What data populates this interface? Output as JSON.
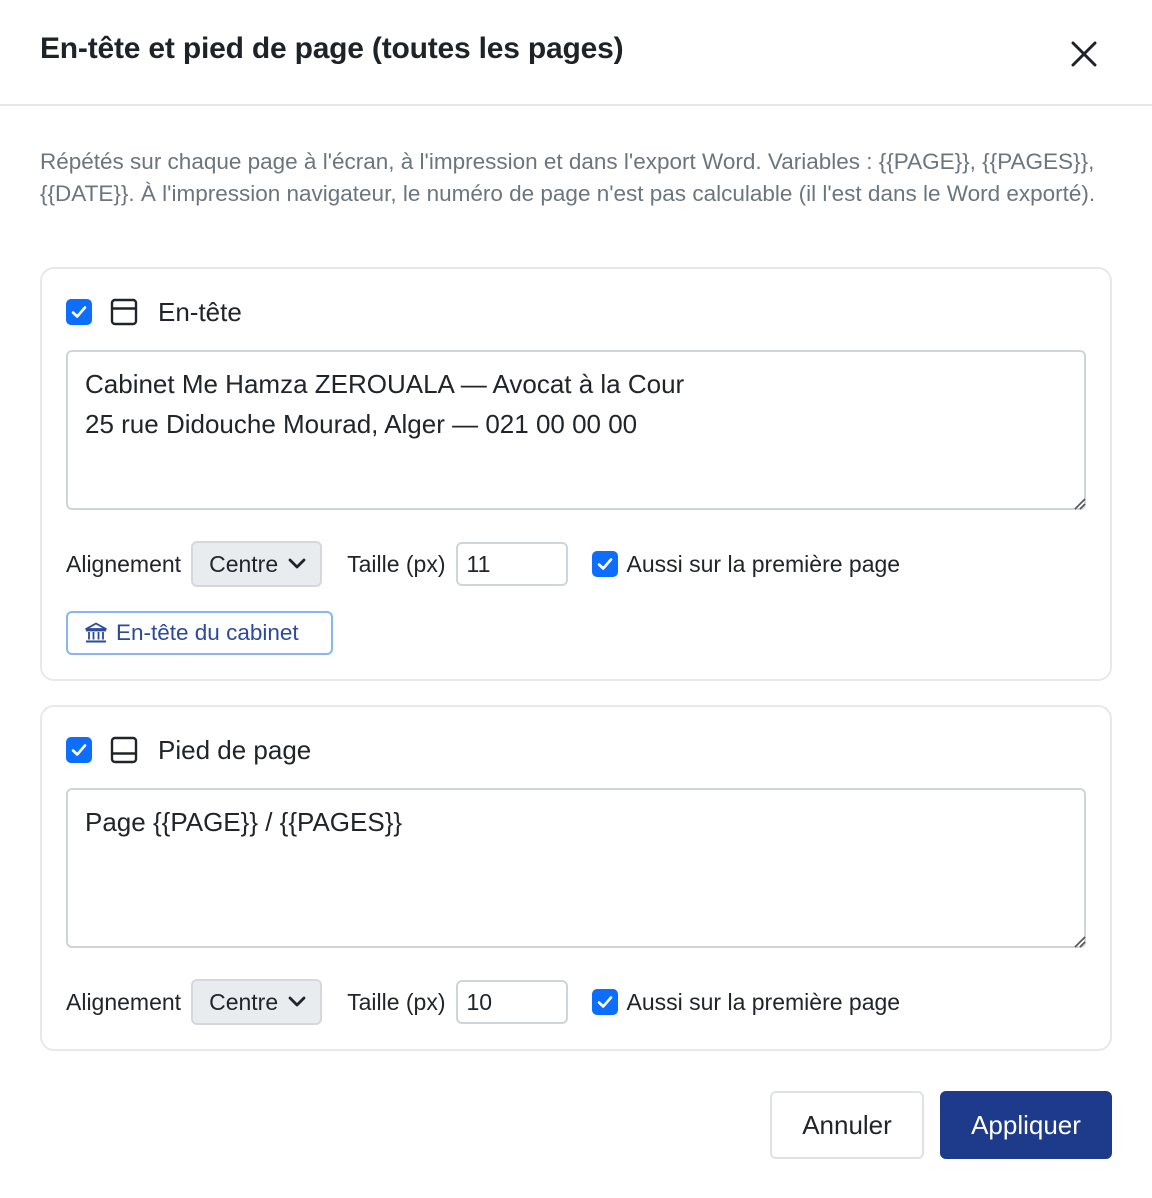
{
  "dialog": {
    "title": "En-tête et pied de page (toutes les pages)",
    "intro": "Répétés sur chaque page à l'écran, à l'impression et dans l'export Word. Variables : {{PAGE}}, {{PAGES}}, {{DATE}}. À l'impression navigateur, le numéro de page n'est pas calculable (il l'est dans le Word exporté)."
  },
  "header_section": {
    "enabled": true,
    "label": "En-tête",
    "icon": "layout-header-icon",
    "text": "Cabinet Me Hamza ZEROUALA — Avocat à la Cour\n25 rue Didouche Mourad, Alger — 021 00 00 00",
    "alignment_label": "Alignement",
    "alignment_value": "Centre",
    "size_label": "Taille (px)",
    "size_value": "11",
    "first_page_checked": true,
    "first_page_label": "Aussi sur la première page",
    "cabinet_button_label": "En-tête du cabinet",
    "cabinet_button_icon": "bank-icon"
  },
  "footer_section": {
    "enabled": true,
    "label": "Pied de page",
    "icon": "layout-footer-icon",
    "text": "Page {{PAGE}} / {{PAGES}}",
    "alignment_label": "Alignement",
    "alignment_value": "Centre",
    "size_label": "Taille (px)",
    "size_value": "10",
    "first_page_checked": true,
    "first_page_label": "Aussi sur la première page"
  },
  "actions": {
    "cancel_label": "Annuler",
    "apply_label": "Appliquer"
  },
  "colors": {
    "primary": "#1e3a8a",
    "checkbox": "#0d6efd",
    "link": "#2b4a9c",
    "muted_text": "#6c757d"
  }
}
